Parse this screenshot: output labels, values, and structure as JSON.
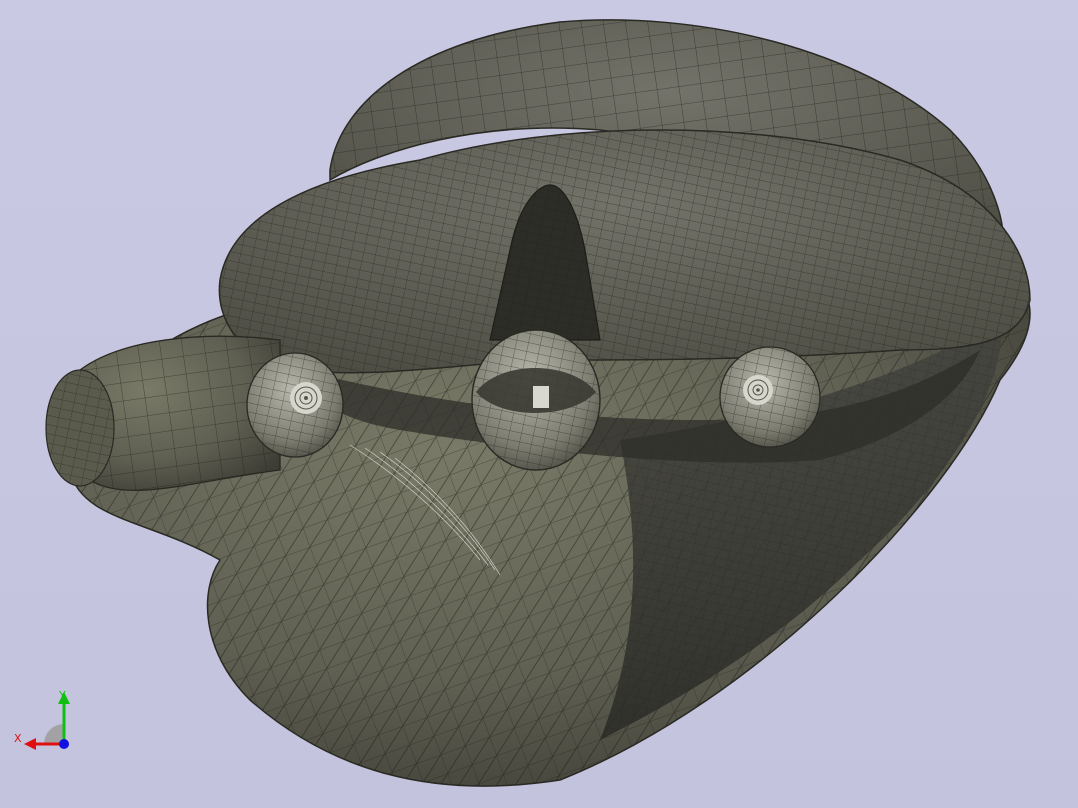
{
  "viewer": {
    "background_top": "#c9c9e3",
    "background_bottom": "#c3c3dd",
    "model_color": "#6c6c5c",
    "mesh_color": "#1e1e18",
    "inner_face_color": "#d8d8cf"
  },
  "axis_triad": {
    "x_label": "X",
    "y_label": "Y",
    "x_color": "#e01010",
    "y_color": "#10c010",
    "z_color": "#1010e0"
  }
}
